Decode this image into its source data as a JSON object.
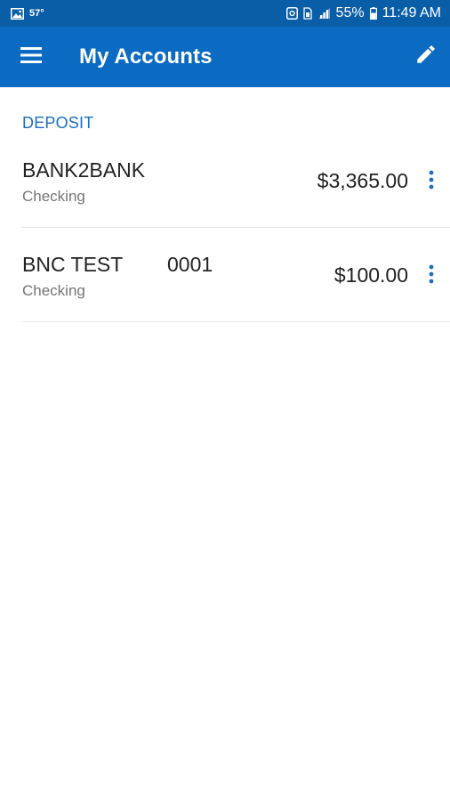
{
  "status_bar": {
    "temperature": "57°",
    "battery_percent": "55%",
    "time": "11:49 AM",
    "icons": [
      "gallery-icon",
      "sync-icon",
      "sim-icon",
      "signal-icon",
      "battery-icon"
    ]
  },
  "app_bar": {
    "title": "My Accounts",
    "menu_icon": "hamburger-menu-icon",
    "edit_icon": "pencil-edit-icon"
  },
  "colors": {
    "status_bar": "#0a5ea8",
    "app_bar": "#0b6bc2",
    "accent": "#1b6ec2"
  },
  "accounts": {
    "section_label": "DEPOSIT",
    "items": [
      {
        "name": "BANK2BANK",
        "number": "",
        "type": "Checking",
        "balance": "$3,365.00"
      },
      {
        "name": "BNC TEST",
        "number": "0001",
        "type": "Checking",
        "balance": "$100.00"
      }
    ]
  }
}
